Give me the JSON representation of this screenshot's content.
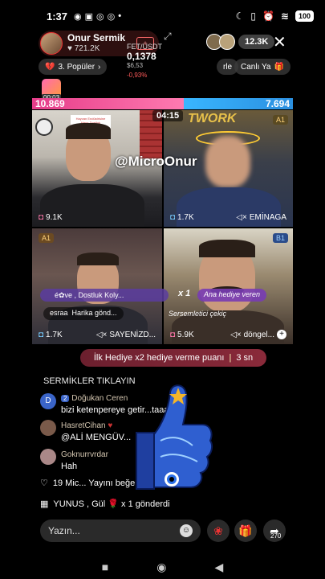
{
  "status_bar": {
    "time": "1:37",
    "battery": "100"
  },
  "host": {
    "name": "Onur Sermik",
    "likes": "721.2K",
    "follow_label": "+"
  },
  "ticker": {
    "symbol": "FET/USDT",
    "price": "0,1378",
    "sub_price": "$6,53",
    "change": "-0,93%"
  },
  "top_right": {
    "viewer_count": "12.3K"
  },
  "chips": {
    "popular": "3. Popüler",
    "rle": "rle",
    "canli": "Canlı Ya",
    "timer_small": "00:03"
  },
  "battle": {
    "left_score": "10.869",
    "right_score": "7.694",
    "timer": "04:15"
  },
  "cells": [
    {
      "count": "9.1K",
      "name": "",
      "badge": "",
      "sign_text": "Hayvan Endüstrisine Hayır Dostluk"
    },
    {
      "count": "1.7K",
      "name": "EMİNAGA",
      "badge": "A1",
      "brand": "TWORK"
    },
    {
      "count": "1.7K",
      "name": "SAYENİZD...",
      "badge": "A1"
    },
    {
      "count": "5.9K",
      "name": "döngel...",
      "badge": "B1"
    }
  ],
  "watermark": "@MicroOnur",
  "overlays": {
    "gift_toast": "é✿ve , Dostluk Koly...",
    "x1": "x 1",
    "gift_toast2": "Ana hediye veren",
    "comment_user": "esraa",
    "comment_text": "Harika gönd...",
    "gift_label": "Sersemletici çekiç"
  },
  "banner": {
    "text": "İlk Hediye x2 hediye verme puanı",
    "countdown": "3 sn"
  },
  "chat": [
    {
      "user": "",
      "text": "SERMİKLER TIKLAYIN"
    },
    {
      "user": "Doğukan Ceren",
      "level": "2",
      "avatar_letter": "D",
      "text": "bizi ketenpereye getir...taaa"
    },
    {
      "user": "HasretCihan",
      "text": "@ALİ MENGÜV..."
    },
    {
      "user": "Goknurrvrdar",
      "text": "Hah"
    },
    {
      "system": "19  Mic... Yayını beğendi",
      "level": "19"
    },
    {
      "system": "YUNUS , Gül 🌹 x 1 gönderdi"
    }
  ],
  "input": {
    "placeholder": "Yazın...",
    "share_count": "270"
  },
  "colors": {
    "battle_left": "#e63d8a",
    "battle_right": "#39b6ff",
    "banner": "#7a2634"
  }
}
